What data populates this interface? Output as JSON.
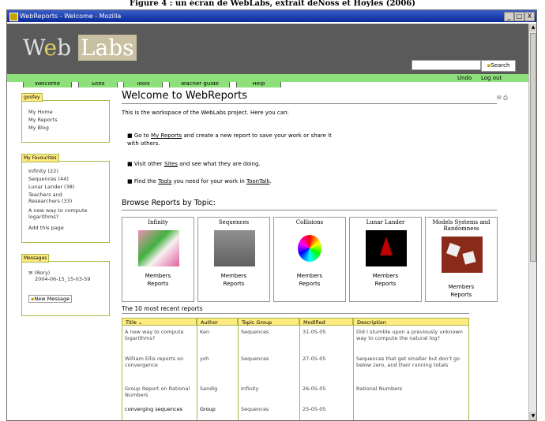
{
  "figure_caption": "Figure 4 : un écran de WebLabs, extrait deNoss et Hoyles (2006)",
  "window": {
    "title": "WebReports - Welcome - Mozilla",
    "buttons": [
      "_",
      "□",
      "X"
    ]
  },
  "header": {
    "logo": {
      "w": "W",
      "e": "e",
      "b": "b",
      "labs": "Labs"
    },
    "search_placeholder": "",
    "search_button": "Search"
  },
  "nav": {
    "tabs": [
      "Welcome",
      "Sites",
      "Tools",
      "Teacher guide",
      "Help"
    ],
    "active_tab": "Welcome",
    "right_links": [
      "Undo",
      "Log out"
    ]
  },
  "sidebar": {
    "user": {
      "title": "goofey",
      "items": [
        "My Home",
        "My Reports",
        "My Blog"
      ]
    },
    "favourites": {
      "title": "My Favourites",
      "items": [
        "Infinity (22)",
        "Sequences (44)",
        "Lunar Lander (38)",
        "Teachers and",
        "Researchers (33)",
        "A new way to compute",
        "logarithms?",
        "Add this page"
      ]
    },
    "messages": {
      "title": "Messages",
      "from": "(Rory)",
      "date": "2004-06-15_15-03-59",
      "new_button": "New Message"
    }
  },
  "main": {
    "title": "Welcome to WebReports",
    "intro": "This is the workspace of the WebLabs project. Here you can:",
    "bullets": [
      {
        "pre": "Go to ",
        "link": "My Reports",
        "post": " and create a new report to save your work or share it with others."
      },
      {
        "pre": "Visit other ",
        "link": "Sites",
        "post": " and see what they are doing."
      },
      {
        "pre": "Find the ",
        "link": "Tools",
        "post": " you need for your work in ",
        "link2": "ToonTalk",
        "post2": "."
      }
    ],
    "browse_title": "Browse Reports by Topic:",
    "topics": [
      {
        "name": "Infinity",
        "members": "Members",
        "reports": "Reports"
      },
      {
        "name": "Sequences",
        "members": "Members",
        "reports": "Reports"
      },
      {
        "name": "Collisions",
        "members": "Members",
        "reports": "Reports"
      },
      {
        "name": "Lunar Lander",
        "members": "Members",
        "reports": "Reports"
      },
      {
        "name": "Models Systems and Randomness",
        "members": "Members",
        "reports": "Reports"
      }
    ],
    "recent_title": "The 10 most recent reports",
    "table": {
      "headers": [
        "Title",
        "Author",
        "Topic Group",
        "Modified",
        "Description"
      ],
      "rows": [
        [
          "A new way to compute logarithms?",
          "Ken",
          "Sequences",
          "31-05-05",
          "Did I stumble upon a previously unknown way to compute the natural log?"
        ],
        [
          "William Ellis reports on convergence",
          "ysh",
          "Sequences",
          "27-05-05",
          "Sequences that get smaller but don't go below zero, and their running totals"
        ],
        [
          "Group Report on Rational Numbers",
          "Sandig",
          "Infinity",
          "26-05-05",
          "Rational Numbers"
        ],
        [
          "converging sequences",
          "Group",
          "Sequences",
          "25-05-05",
          ""
        ]
      ]
    }
  }
}
